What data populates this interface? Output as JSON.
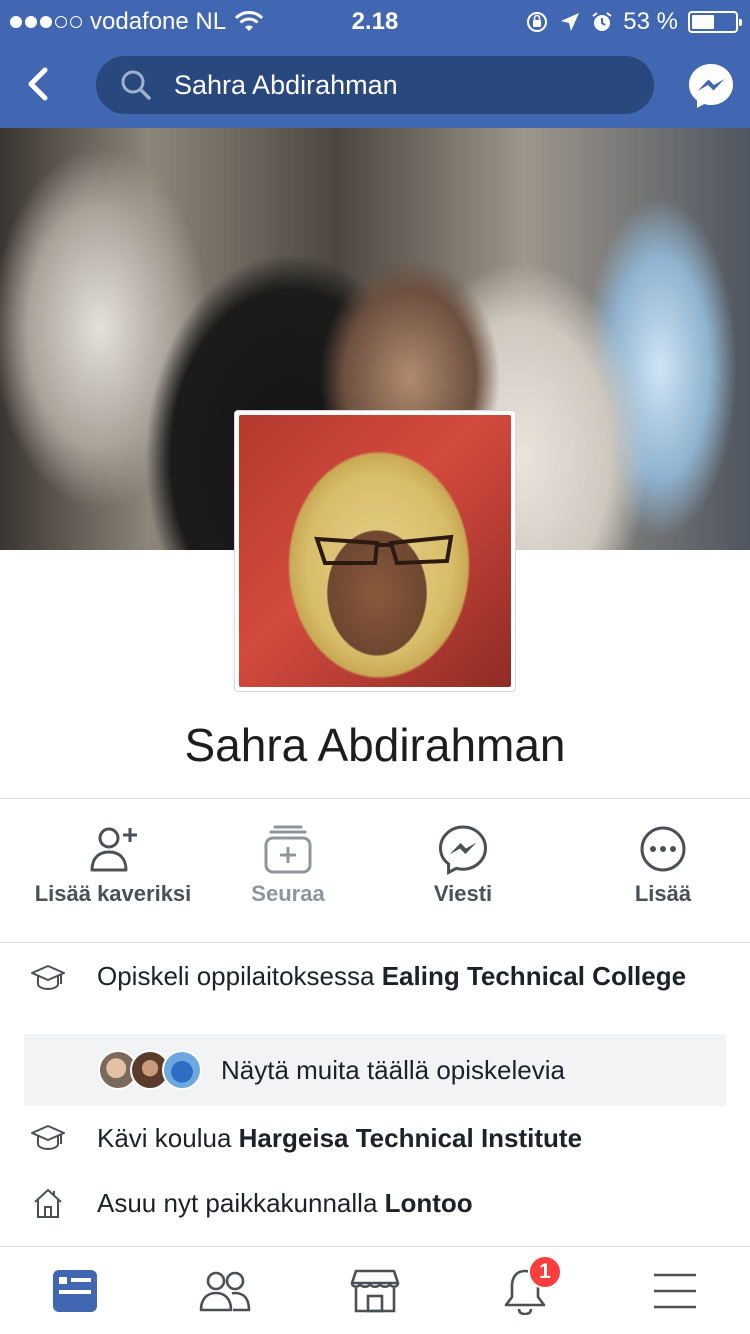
{
  "status_bar": {
    "carrier": "vodafone NL",
    "time": "2.18",
    "battery": "53 %",
    "signal_bars_filled": 3,
    "signal_bars_total": 5,
    "battery_level": 0.53
  },
  "header": {
    "search_text": "Sahra Abdirahman",
    "back_icon": "chevron-left-icon",
    "messenger_icon": "messenger-icon"
  },
  "profile": {
    "name": "Sahra Abdirahman"
  },
  "actions": [
    {
      "label": "Lisää kaveriksi",
      "icon": "add-friend-icon"
    },
    {
      "label": "Seuraa",
      "icon": "follow-icon"
    },
    {
      "label": "Viesti",
      "icon": "messenger-icon"
    },
    {
      "label": "Lisää",
      "icon": "more-icon"
    }
  ],
  "about": {
    "studied_prefix": "Opiskeli oppilaitoksessa ",
    "studied_place": "Ealing Technical College",
    "see_others": "Näytä muita täällä opiskelevia",
    "school_prefix": "Kävi koulua ",
    "school_place": "Hargeisa Technical Institute",
    "lives_prefix": "Asuu nyt paikkakunnalla ",
    "lives_place": "Lontoo"
  },
  "tabbar": {
    "notifications_badge": "1",
    "tabs": [
      "news-feed-icon",
      "friends-icon",
      "marketplace-icon",
      "notifications-icon",
      "menu-icon"
    ]
  },
  "colors": {
    "brand_blue": "#4267b2",
    "search_bg": "#29487d",
    "badge_red": "#fa3e3e"
  }
}
